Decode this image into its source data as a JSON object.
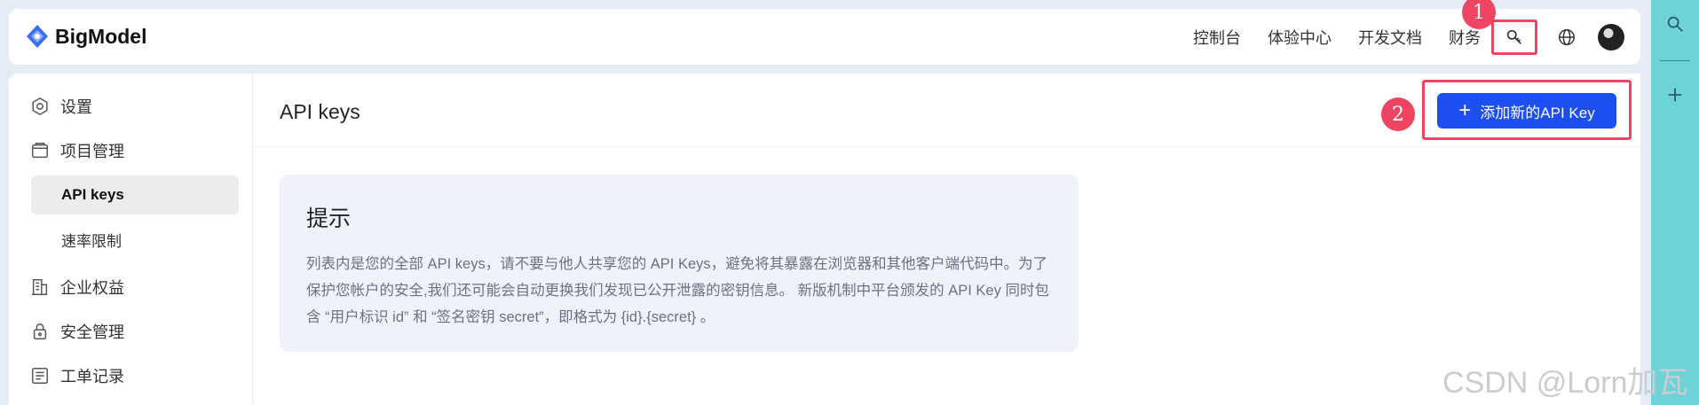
{
  "brand": {
    "name": "BigModel"
  },
  "topnav": {
    "items": [
      "控制台",
      "体验中心",
      "开发文档",
      "财务"
    ],
    "icons": [
      "key-icon",
      "globe-icon",
      "avatar"
    ]
  },
  "annotations": {
    "badge1": "1",
    "badge2": "2"
  },
  "sidebar": {
    "items": [
      {
        "label": "设置",
        "icon": "settings-icon"
      },
      {
        "label": "项目管理",
        "icon": "folder-icon"
      },
      {
        "label": "API keys",
        "active": true
      },
      {
        "label": "速率限制"
      },
      {
        "label": "企业权益",
        "icon": "building-icon"
      },
      {
        "label": "安全管理",
        "icon": "lock-icon"
      },
      {
        "label": "工单记录",
        "icon": "ticket-icon"
      }
    ]
  },
  "main": {
    "title": "API keys",
    "add_button": "添加新的API Key",
    "tip": {
      "title": "提示",
      "body": "列表内是您的全部 API keys，请不要与他人共享您的 API Keys，避免将其暴露在浏览器和其他客户端代码中。为了保护您帐户的安全,我们还可能会自动更换我们发现已公开泄露的密钥信息。 新版机制中平台颁发的 API Key 同时包含 “用户标识 id” 和 “签名密钥 secret”，即格式为 {id}.{secret} 。"
    }
  },
  "right_strip": {
    "icons": [
      "search-icon",
      "plus-icon"
    ]
  },
  "watermark": "CSDN @Lorn加瓦",
  "colors": {
    "primary": "#1d4ef0",
    "highlight": "#ef4563",
    "tip_bg": "#eff2fb",
    "strip": "#6dd3d6"
  }
}
